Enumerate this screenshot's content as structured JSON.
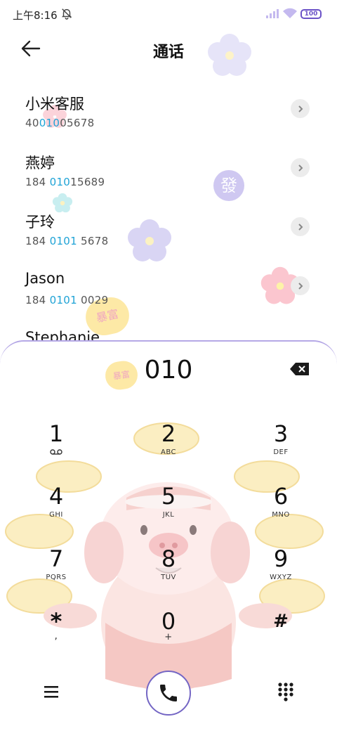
{
  "status_bar": {
    "time": "上午8:16",
    "battery": "100"
  },
  "header": {
    "title": "通话"
  },
  "contacts": [
    {
      "name": "小米客服",
      "number_pre": "40",
      "number_hl": "010",
      "number_post": "05678"
    },
    {
      "name": "燕婷",
      "number_pre": "184 ",
      "number_hl": "010",
      "number_post": "15689"
    },
    {
      "name": "子玲",
      "number_pre": "184 ",
      "number_hl": "0101",
      "number_post": " 5678"
    },
    {
      "name": "Jason",
      "number_pre": "184 ",
      "number_hl": "0101",
      "number_post": " 0029"
    },
    {
      "name": "Stephanie",
      "number_pre": "",
      "number_hl": "",
      "number_post": ""
    }
  ],
  "dialer": {
    "input": "010",
    "keys": [
      {
        "digit": "1",
        "letters": ""
      },
      {
        "digit": "2",
        "letters": "ABC"
      },
      {
        "digit": "3",
        "letters": "DEF"
      },
      {
        "digit": "4",
        "letters": "GHI"
      },
      {
        "digit": "5",
        "letters": "JKL"
      },
      {
        "digit": "6",
        "letters": "MNO"
      },
      {
        "digit": "7",
        "letters": "PQRS"
      },
      {
        "digit": "8",
        "letters": "TUV"
      },
      {
        "digit": "9",
        "letters": "WXYZ"
      },
      {
        "digit": "*",
        "letters": ","
      },
      {
        "digit": "0",
        "letters": "+"
      },
      {
        "digit": "#",
        "letters": ""
      }
    ]
  },
  "wallpaper": {
    "sticker_baofu": "暴富",
    "sticker_fa": "發"
  },
  "colors": {
    "accent": "#7466c4",
    "highlight": "#1fa3d6",
    "panel_border": "#b5a8e6"
  }
}
